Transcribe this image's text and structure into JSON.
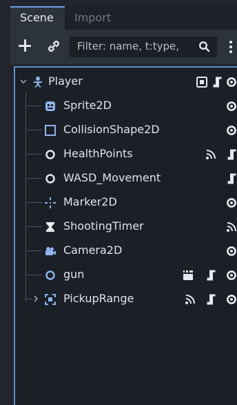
{
  "tabs": {
    "scene": "Scene",
    "import": "Import"
  },
  "toolbar": {
    "filter_placeholder": "Filter: name, t:type,"
  },
  "colors": {
    "accent_border": "#5f8fd0",
    "icon_blue": "#8fb4f0",
    "icon_white": "#e6e9ed"
  },
  "tree": {
    "root": {
      "label": "Player",
      "icon": "character-body-icon",
      "expanded": true,
      "indicators": [
        "group-icon",
        "script-icon",
        "visibility-icon"
      ]
    },
    "children": [
      {
        "label": "Sprite2D",
        "icon": "sprite-icon",
        "indicators": [
          "visibility-icon"
        ]
      },
      {
        "label": "CollisionShape2D",
        "icon": "collision-shape-icon",
        "indicators": [
          "visibility-icon"
        ]
      },
      {
        "label": "HealthPoints",
        "icon": "node-icon",
        "indicators": [
          "signal-icon",
          "script-icon"
        ]
      },
      {
        "label": "WASD_Movement",
        "icon": "node-icon",
        "indicators": [
          "script-icon"
        ]
      },
      {
        "label": "Marker2D",
        "icon": "marker-icon",
        "indicators": [
          "visibility-icon"
        ]
      },
      {
        "label": "ShootingTimer",
        "icon": "timer-icon",
        "indicators": [
          "signal-icon"
        ]
      },
      {
        "label": "Camera2D",
        "icon": "camera-icon",
        "indicators": [
          "visibility-icon"
        ]
      },
      {
        "label": "gun",
        "icon": "node2d-icon",
        "indicators": [
          "instance-icon",
          "script-icon",
          "visibility-icon"
        ]
      },
      {
        "label": "PickupRange",
        "icon": "area-icon",
        "collapsed": true,
        "indicators": [
          "signal-icon",
          "script-icon",
          "visibility-icon"
        ]
      }
    ]
  }
}
